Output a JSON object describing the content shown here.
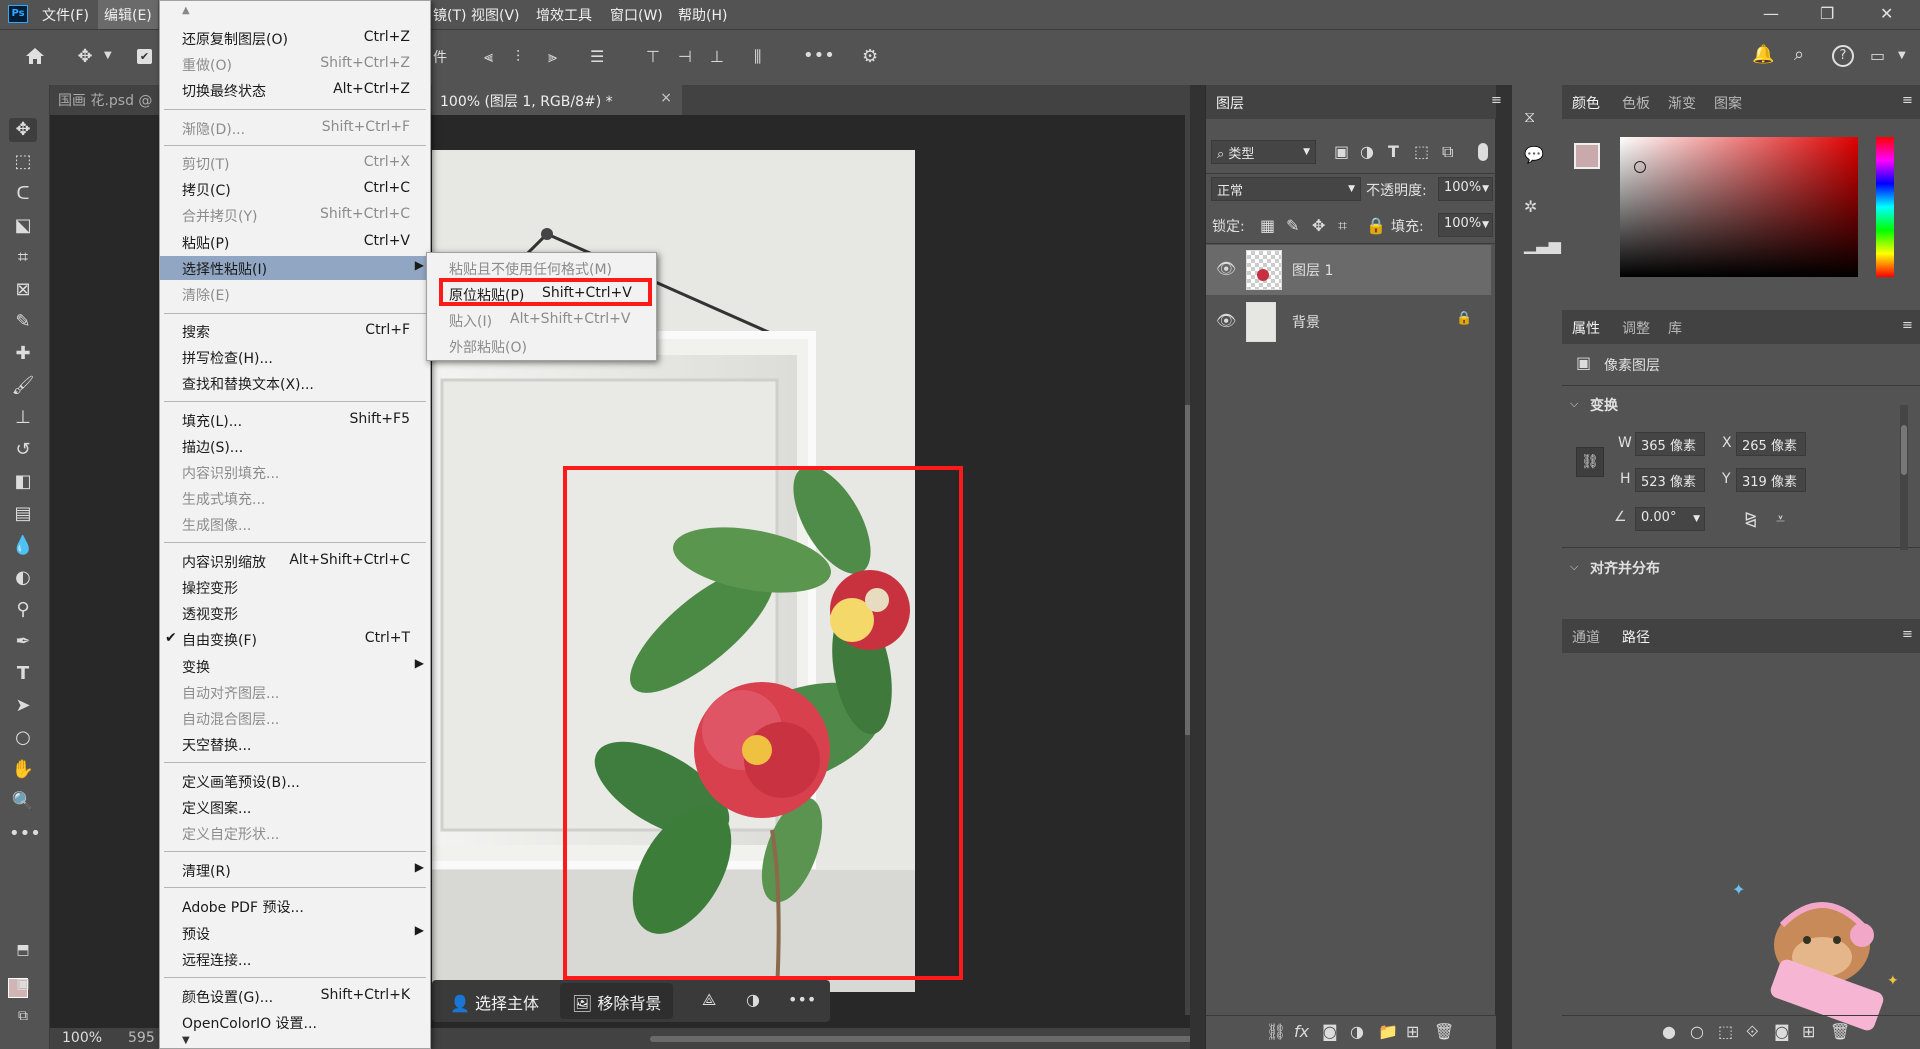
{
  "menubar": {
    "ps_logo": "Ps",
    "file": "文件(F)",
    "edit": "编辑(E)",
    "filter_partial": "镜(T)",
    "view": "视图(V)",
    "plugins": "增效工具",
    "window": "窗口(W)",
    "help": "帮助(H)"
  },
  "window_controls": {
    "minimize": "—",
    "restore": "❐",
    "close": "✕"
  },
  "tabs": {
    "doc1": "国画 花.psd @",
    "doc2": "100% (图层 1, RGB/8#) *",
    "doc2_close": "×"
  },
  "optbar": {
    "partial_label": "件"
  },
  "status": {
    "zoom": "100%",
    "size_partial": "595"
  },
  "edit_menu": {
    "undo": {
      "label": "还原复制图层(O)",
      "shortcut": "Ctrl+Z"
    },
    "redo": {
      "label": "重做(O)",
      "shortcut": "Shift+Ctrl+Z"
    },
    "toggle_last": {
      "label": "切换最终状态",
      "shortcut": "Alt+Ctrl+Z"
    },
    "fade": {
      "label": "渐隐(D)...",
      "shortcut": "Shift+Ctrl+F"
    },
    "cut": {
      "label": "剪切(T)",
      "shortcut": "Ctrl+X"
    },
    "copy": {
      "label": "拷贝(C)",
      "shortcut": "Ctrl+C"
    },
    "copy_merged": {
      "label": "合并拷贝(Y)",
      "shortcut": "Shift+Ctrl+C"
    },
    "paste": {
      "label": "粘贴(P)",
      "shortcut": "Ctrl+V"
    },
    "paste_special": {
      "label": "选择性粘贴(I)"
    },
    "clear": {
      "label": "清除(E)"
    },
    "search": {
      "label": "搜索",
      "shortcut": "Ctrl+F"
    },
    "spell": {
      "label": "拼写检查(H)..."
    },
    "find_replace": {
      "label": "查找和替换文本(X)..."
    },
    "fill": {
      "label": "填充(L)...",
      "shortcut": "Shift+F5"
    },
    "stroke": {
      "label": "描边(S)..."
    },
    "content_fill": {
      "label": "内容识别填充..."
    },
    "gen_fill": {
      "label": "生成式填充..."
    },
    "gen_image": {
      "label": "生成图像..."
    },
    "content_scale": {
      "label": "内容识别缩放",
      "shortcut": "Alt+Shift+Ctrl+C"
    },
    "puppet": {
      "label": "操控变形"
    },
    "perspective": {
      "label": "透视变形"
    },
    "free_transform": {
      "label": "自由变换(F)",
      "shortcut": "Ctrl+T",
      "check": "✔"
    },
    "transform": {
      "label": "变换"
    },
    "auto_align": {
      "label": "自动对齐图层..."
    },
    "auto_blend": {
      "label": "自动混合图层..."
    },
    "sky_replace": {
      "label": "天空替换..."
    },
    "define_brush": {
      "label": "定义画笔预设(B)..."
    },
    "define_pattern": {
      "label": "定义图案..."
    },
    "define_shape": {
      "label": "定义自定形状..."
    },
    "purge": {
      "label": "清理(R)"
    },
    "pdf_presets": {
      "label": "Adobe PDF 预设..."
    },
    "presets": {
      "label": "预设"
    },
    "remote": {
      "label": "远程连接..."
    },
    "color_settings": {
      "label": "颜色设置(G)...",
      "shortcut": "Shift+Ctrl+K"
    },
    "ocio": {
      "label": "OpenColorIO 设置..."
    },
    "submenu_arrow": "▶",
    "scroll_up": "▲",
    "scroll_down": "▼"
  },
  "paste_submenu": {
    "no_format": {
      "label": "粘贴且不使用任何格式(M)"
    },
    "in_place": {
      "label": "原位粘贴(P)",
      "shortcut": "Shift+Ctrl+V"
    },
    "paste_into": {
      "label": "贴入(I)",
      "shortcut": "Alt+Shift+Ctrl+V"
    },
    "paste_outside": {
      "label": "外部粘贴(O)"
    }
  },
  "contextual_bar": {
    "select_subject": "选择主体",
    "remove_bg": "移除背景",
    "more": "•••"
  },
  "layers_panel": {
    "title": "图层",
    "filter_kind": "类型",
    "blend_mode": "正常",
    "opacity_label": "不透明度:",
    "opacity_value": "100%",
    "lock_label": "锁定:",
    "fill_label": "填充:",
    "fill_value": "100%",
    "layers": [
      {
        "name": "图层 1"
      },
      {
        "name": "背景"
      }
    ]
  },
  "color_panel": {
    "tabs": [
      "颜色",
      "色板",
      "渐变",
      "图案"
    ]
  },
  "properties_panel": {
    "tabs": [
      "属性",
      "调整",
      "库"
    ],
    "kind": "像素图层",
    "transform_title": "变换",
    "w_label": "W",
    "w_value": "365 像素",
    "x_label": "X",
    "x_value": "265 像素",
    "h_label": "H",
    "h_value": "523 像素",
    "y_label": "Y",
    "y_value": "319 像素",
    "angle_value": "0.00°",
    "align_title": "对齐并分布"
  },
  "paths_panel": {
    "tabs": [
      "通道",
      "路径"
    ]
  },
  "colors": {
    "accent_red": "#ff1a1a",
    "menu_highlight": "#91a6c3",
    "panel_bg": "#535353",
    "canvas_bg": "#282828"
  }
}
